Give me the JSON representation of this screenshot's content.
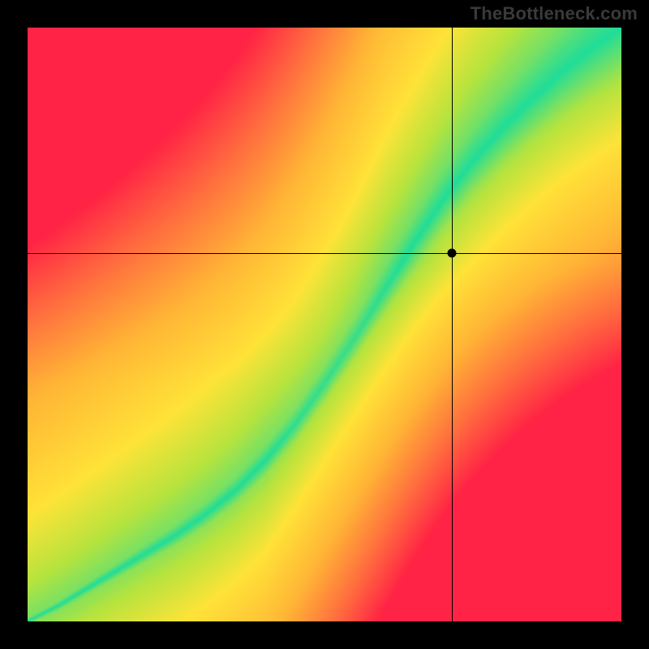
{
  "watermark": "TheBottleneck.com",
  "chart_data": {
    "type": "heatmap",
    "title": "",
    "xlabel": "",
    "ylabel": "",
    "xlim": [
      0,
      1
    ],
    "ylim": [
      0,
      1
    ],
    "crosshair": {
      "x": 0.715,
      "y": 0.62
    },
    "marker": {
      "x": 0.715,
      "y": 0.62
    },
    "ridge": {
      "description": "Green optimal band centroid y as function of x (0..1, y measured from top)",
      "points": [
        {
          "x": 0.0,
          "y": 1.0
        },
        {
          "x": 0.05,
          "y": 0.975
        },
        {
          "x": 0.1,
          "y": 0.945
        },
        {
          "x": 0.15,
          "y": 0.915
        },
        {
          "x": 0.2,
          "y": 0.885
        },
        {
          "x": 0.25,
          "y": 0.855
        },
        {
          "x": 0.3,
          "y": 0.82
        },
        {
          "x": 0.35,
          "y": 0.78
        },
        {
          "x": 0.4,
          "y": 0.73
        },
        {
          "x": 0.45,
          "y": 0.67
        },
        {
          "x": 0.5,
          "y": 0.6
        },
        {
          "x": 0.55,
          "y": 0.525
        },
        {
          "x": 0.6,
          "y": 0.445
        },
        {
          "x": 0.65,
          "y": 0.365
        },
        {
          "x": 0.7,
          "y": 0.29
        },
        {
          "x": 0.75,
          "y": 0.225
        },
        {
          "x": 0.8,
          "y": 0.17
        },
        {
          "x": 0.85,
          "y": 0.12
        },
        {
          "x": 0.9,
          "y": 0.075
        },
        {
          "x": 0.95,
          "y": 0.035
        },
        {
          "x": 1.0,
          "y": 0.0
        }
      ],
      "half_width": {
        "description": "Approx half-width of green band (fraction of plot height) vs x",
        "points": [
          {
            "x": 0.0,
            "w": 0.005
          },
          {
            "x": 0.1,
            "w": 0.01
          },
          {
            "x": 0.2,
            "w": 0.015
          },
          {
            "x": 0.3,
            "w": 0.02
          },
          {
            "x": 0.4,
            "w": 0.025
          },
          {
            "x": 0.5,
            "w": 0.032
          },
          {
            "x": 0.6,
            "w": 0.04
          },
          {
            "x": 0.7,
            "w": 0.05
          },
          {
            "x": 0.8,
            "w": 0.06
          },
          {
            "x": 0.9,
            "w": 0.072
          },
          {
            "x": 1.0,
            "w": 0.085
          }
        ]
      }
    },
    "color_stops": [
      {
        "t": 0.0,
        "color": "#20dd99"
      },
      {
        "t": 0.18,
        "color": "#b8e43e"
      },
      {
        "t": 0.32,
        "color": "#ffe338"
      },
      {
        "t": 0.55,
        "color": "#ffb636"
      },
      {
        "t": 0.78,
        "color": "#ff6f3f"
      },
      {
        "t": 1.0,
        "color": "#ff2445"
      }
    ]
  }
}
